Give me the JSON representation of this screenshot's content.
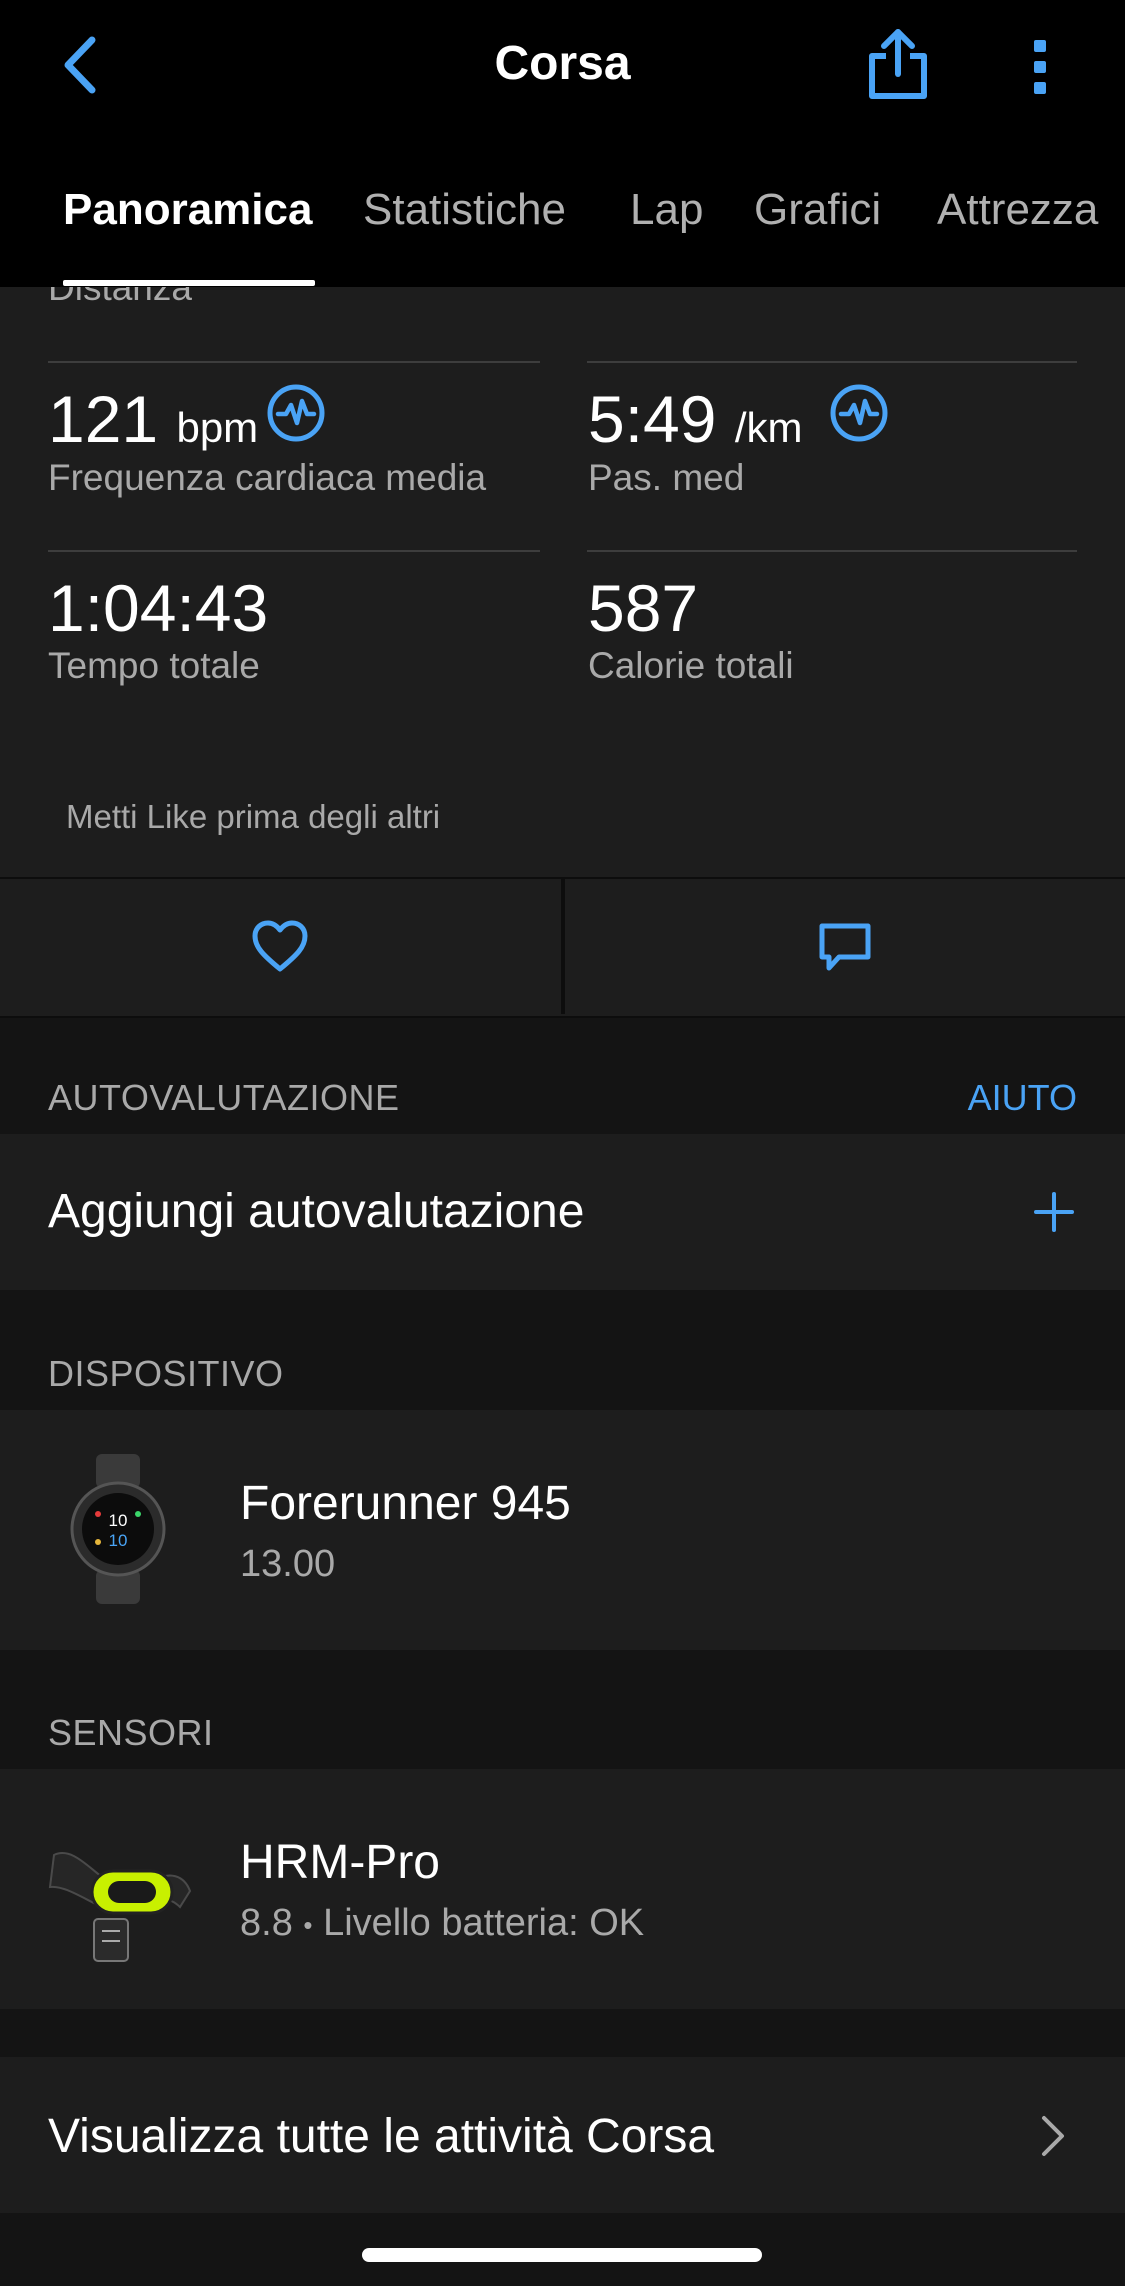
{
  "header": {
    "title": "Corsa",
    "back_icon": "chevron-left-icon",
    "share_icon": "share-icon",
    "more_icon": "more-vertical-icon",
    "accent_color": "#4aa3f5",
    "tabs": [
      {
        "label": "Panoramica",
        "active": true
      },
      {
        "label": "Statistiche",
        "active": false
      },
      {
        "label": "Lap",
        "active": false
      },
      {
        "label": "Grafici",
        "active": false
      },
      {
        "label": "Attrezza",
        "active": false
      }
    ]
  },
  "stats": {
    "partial_label": "Distanza",
    "items": [
      {
        "value": "121",
        "unit": "bpm",
        "label": "Frequenza cardiaca media",
        "icon": "heart-rate-icon"
      },
      {
        "value": "5:49",
        "unit": "/km",
        "label": "Pas. med",
        "icon": "heart-rate-icon"
      },
      {
        "value": "1:04:43",
        "unit": "",
        "label": "Tempo totale"
      },
      {
        "value": "587",
        "unit": "",
        "label": "Calorie totali"
      }
    ],
    "like_prompt": "Metti Like prima degli altri"
  },
  "actions": {
    "like_icon": "heart-outline-icon",
    "comment_icon": "comment-icon"
  },
  "self_evaluation": {
    "section_title": "AUTOVALUTAZIONE",
    "help_label": "AIUTO",
    "add_label": "Aggiungi autovalutazione",
    "add_icon": "plus-icon"
  },
  "device": {
    "section_title": "DISPOSITIVO",
    "name": "Forerunner 945",
    "version": "13.00",
    "watch_face_top": "10",
    "watch_face_bottom": "10"
  },
  "sensors": {
    "section_title": "SENSORI",
    "name": "HRM-Pro",
    "version": "8.8",
    "separator": "•",
    "battery": "Livello batteria: OK"
  },
  "all_activities": {
    "label": "Visualizza tutte le attività Corsa",
    "icon": "chevron-right-icon"
  }
}
